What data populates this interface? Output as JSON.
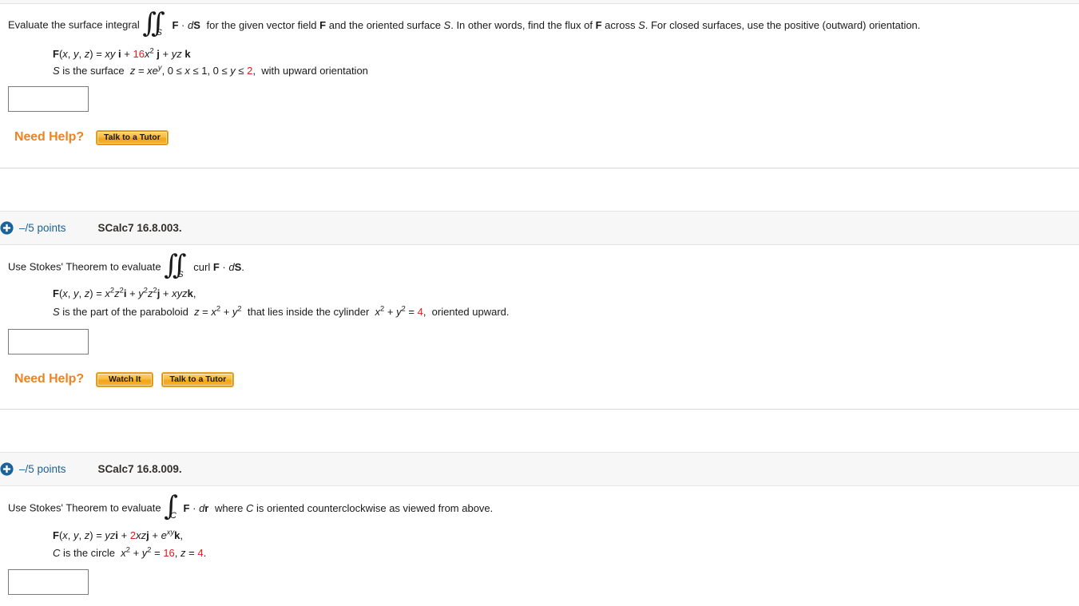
{
  "page": {
    "background": "#ffffff",
    "accent_orange": "#ec8421",
    "accent_blue": "#1f6193",
    "red": "#e01b1b",
    "header_bg": "#f7f7f7"
  },
  "questions": [
    {
      "id": "q1",
      "prompt_lead": "Evaluate the surface integral",
      "integral": {
        "symbol": "double",
        "subscript": "S"
      },
      "prompt_mid": "F · dS",
      "prompt_tail": "for the given vector field F and the oriented surface S. In other words, find the flux of F across S. For closed surfaces, use the positive (outward) orientation.",
      "field_line": "F(x, y, z) = xy i + 16x² j + yz k",
      "field_coefficient": "16",
      "surface_line": "S is the surface  z = xeʸ, 0 ≤ x ≤ 1, 0 ≤ y ≤ 2,  with upward orientation",
      "surface_bound": "2",
      "answer_value": "",
      "answer_placeholder": "",
      "need_help_label": "Need Help?",
      "help_buttons": [
        "Talk to a Tutor"
      ]
    },
    {
      "id": "q2",
      "header": {
        "plus_icon": "plus-circle-icon",
        "points": "–/5 points",
        "code": "SCalc7 16.8.003."
      },
      "prompt_lead": "Use Stokes' Theorem to evaluate",
      "integral": {
        "symbol": "double",
        "subscript": "S"
      },
      "prompt_tail": "curl F · dS.",
      "field_line": "F(x, y, z) = x²z²i + y²z²j + xyzk,",
      "surface_line": "S is the part of the paraboloid  z = x² + y²  that lies inside the cylinder  x² + y² = 4,  oriented upward.",
      "cylinder_radius_squared": "4",
      "answer_value": "",
      "answer_placeholder": "",
      "need_help_label": "Need Help?",
      "help_buttons": [
        "Watch It",
        "Talk to a Tutor"
      ]
    },
    {
      "id": "q3",
      "header": {
        "plus_icon": "plus-circle-icon",
        "points": "–/5 points",
        "code": "SCalc7 16.8.009."
      },
      "prompt_lead": "Use Stokes' Theorem to evaluate",
      "integral": {
        "symbol": "single",
        "subscript": "C"
      },
      "prompt_mid": "F · dr",
      "prompt_tail": "where C is oriented counterclockwise as viewed from above.",
      "field_line": "F(x, y, z) = yzi + 2xzj + eˣʸk,",
      "field_coefficient": "2",
      "curve_line": "C is the circle  x² + y² = 16, z = 4.",
      "circle_radius_squared": "16",
      "circle_height": "4",
      "answer_value": "",
      "answer_placeholder": ""
    }
  ]
}
